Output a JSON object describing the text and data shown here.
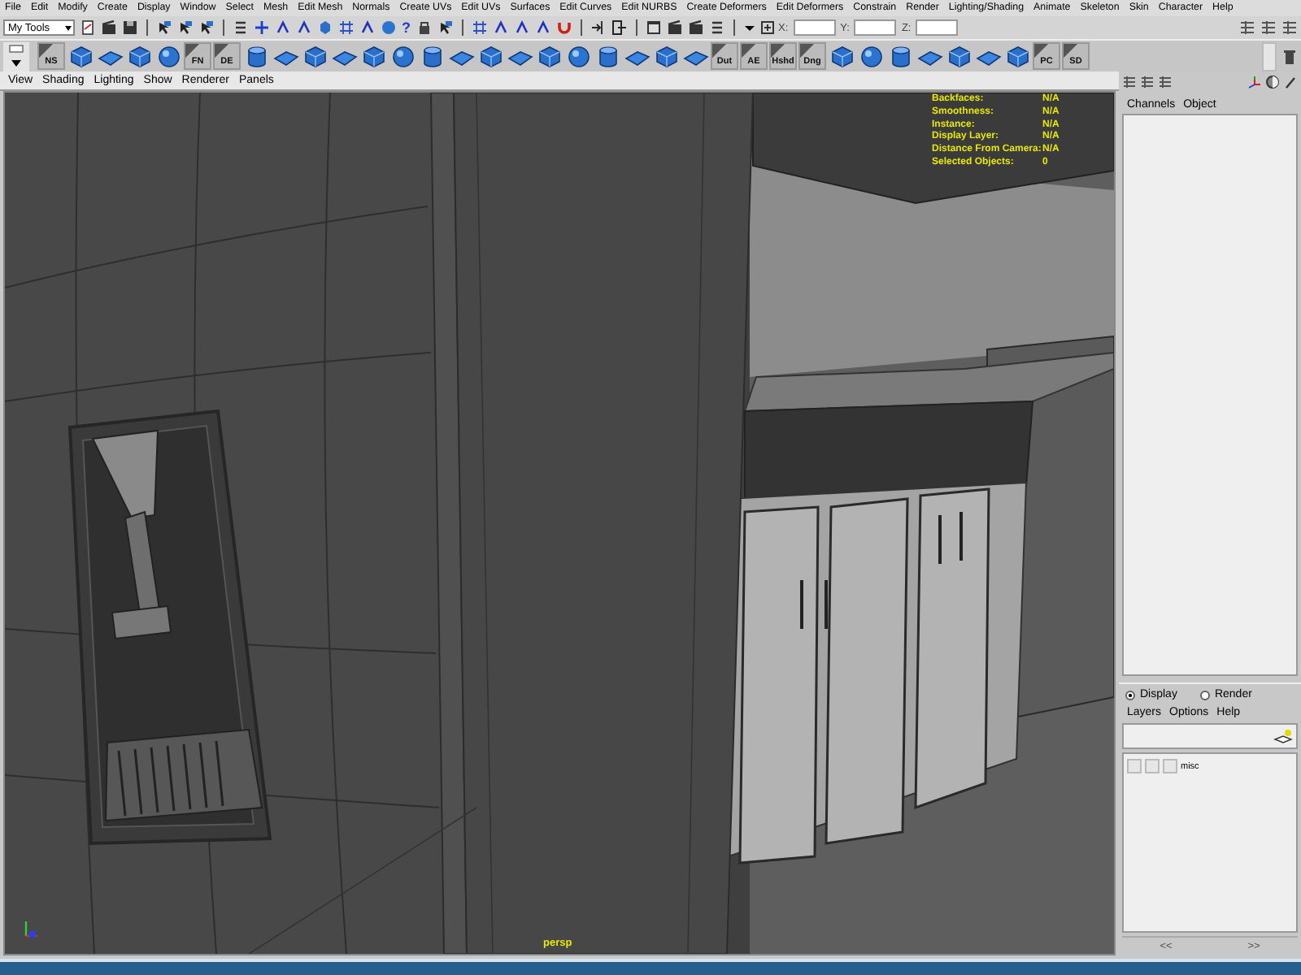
{
  "menu_bar": [
    "File",
    "Edit",
    "Modify",
    "Create",
    "Display",
    "Window",
    "Select",
    "Mesh",
    "Edit Mesh",
    "Normals",
    "Create UVs",
    "Edit UVs",
    "Surfaces",
    "Edit Curves",
    "Edit NURBS",
    "Create Deformers",
    "Edit Deformers",
    "Constrain",
    "Render",
    "Lighting/Shading",
    "Animate",
    "Skeleton",
    "Skin",
    "Character",
    "Help"
  ],
  "status_line": {
    "menu_set": "My Tools",
    "help_glyph": "?",
    "coord_labels": [
      "X:",
      "Y:",
      "Z:"
    ]
  },
  "shelf": [
    {
      "kind": "label",
      "label": "NS"
    },
    {
      "kind": "icon"
    },
    {
      "kind": "icon"
    },
    {
      "kind": "icon"
    },
    {
      "kind": "icon"
    },
    {
      "kind": "label",
      "label": "FN"
    },
    {
      "kind": "label",
      "label": "DE"
    },
    {
      "kind": "icon"
    },
    {
      "kind": "icon"
    },
    {
      "kind": "icon"
    },
    {
      "kind": "icon"
    },
    {
      "kind": "icon"
    },
    {
      "kind": "icon"
    },
    {
      "kind": "icon"
    },
    {
      "kind": "icon"
    },
    {
      "kind": "icon"
    },
    {
      "kind": "icon"
    },
    {
      "kind": "icon"
    },
    {
      "kind": "icon"
    },
    {
      "kind": "icon"
    },
    {
      "kind": "icon"
    },
    {
      "kind": "icon"
    },
    {
      "kind": "icon"
    },
    {
      "kind": "label",
      "label": "Dut"
    },
    {
      "kind": "label",
      "label": "AE"
    },
    {
      "kind": "label",
      "label": "Hshd"
    },
    {
      "kind": "label",
      "label": "Dng"
    },
    {
      "kind": "icon"
    },
    {
      "kind": "icon"
    },
    {
      "kind": "icon"
    },
    {
      "kind": "icon"
    },
    {
      "kind": "icon"
    },
    {
      "kind": "icon"
    },
    {
      "kind": "icon"
    },
    {
      "kind": "label",
      "label": "PC"
    },
    {
      "kind": "label",
      "label": "SD"
    }
  ],
  "viewport": {
    "menu": [
      "View",
      "Shading",
      "Lighting",
      "Show",
      "Renderer",
      "Panels"
    ],
    "hud": [
      {
        "label": "Backfaces:",
        "value": "N/A"
      },
      {
        "label": "Smoothness:",
        "value": "N/A"
      },
      {
        "label": "Instance:",
        "value": "N/A"
      },
      {
        "label": "Display Layer:",
        "value": "N/A"
      },
      {
        "label": "Distance From Camera:",
        "value": "N/A"
      },
      {
        "label": "Selected Objects:",
        "value": "0"
      }
    ],
    "camera": "persp"
  },
  "channel_box": {
    "menu": [
      "Channels",
      "Object"
    ]
  },
  "layer_editor": {
    "modes": [
      {
        "label": "Display",
        "selected": true
      },
      {
        "label": "Render",
        "selected": false
      }
    ],
    "menu": [
      "Layers",
      "Options",
      "Help"
    ],
    "layers": [
      {
        "name": "misc"
      }
    ],
    "scroll_left": "<<",
    "scroll_right": ">>"
  }
}
